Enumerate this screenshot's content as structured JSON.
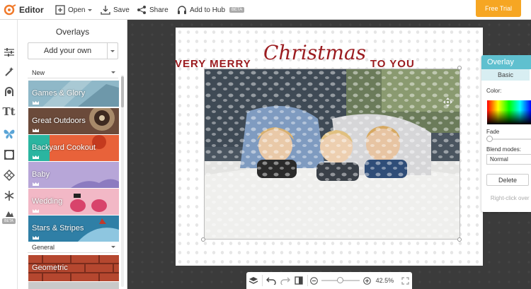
{
  "app": {
    "title": "Editor"
  },
  "toolbar": {
    "open_label": "Open",
    "save_label": "Save",
    "share_label": "Share",
    "add_to_hub_label": "Add to Hub",
    "beta_label": "BETA",
    "free_trial_label": "Free Trial"
  },
  "rail": {
    "icons": [
      "sliders-icon",
      "magic-wand-icon",
      "face-icon",
      "text-icon",
      "butterfly-icon",
      "frame-icon",
      "texture-icon",
      "snowflake-icon",
      "beta-icon"
    ],
    "beta_label": "BETA"
  },
  "panel": {
    "title": "Overlays",
    "add_own_label": "Add your own",
    "sections": [
      "New",
      "General"
    ],
    "tiles": [
      {
        "label": "Games & Glory",
        "color": "#8fb8c8"
      },
      {
        "label": "Great Outdoors",
        "color": "#6b4a3a"
      },
      {
        "label": "Backyard Cookout",
        "color": "#e8623a"
      },
      {
        "label": "Baby",
        "color": "#b7a6d8"
      },
      {
        "label": "Wedding",
        "color": "#f2b8c6"
      },
      {
        "label": "Stars & Stripes",
        "color": "#2f7fa6"
      },
      {
        "label": "Geometric",
        "color": "#b5472f"
      }
    ]
  },
  "canvas": {
    "headline": "VERY MERRY",
    "headline_script": "Christmas",
    "headline_tail": "TO YOU"
  },
  "bottombar": {
    "zoom": "42.5%"
  },
  "props": {
    "title": "Overlay",
    "tab": "Basic",
    "color_label": "Color:",
    "fade_label": "Fade",
    "blend_label": "Blend modes:",
    "blend_value": "Normal",
    "delete_label": "Delete",
    "hint": "Right-click over optio"
  },
  "colors": {
    "accent": "#5fc0cf",
    "trial": "#f6a623",
    "headline": "#9b1c20"
  }
}
